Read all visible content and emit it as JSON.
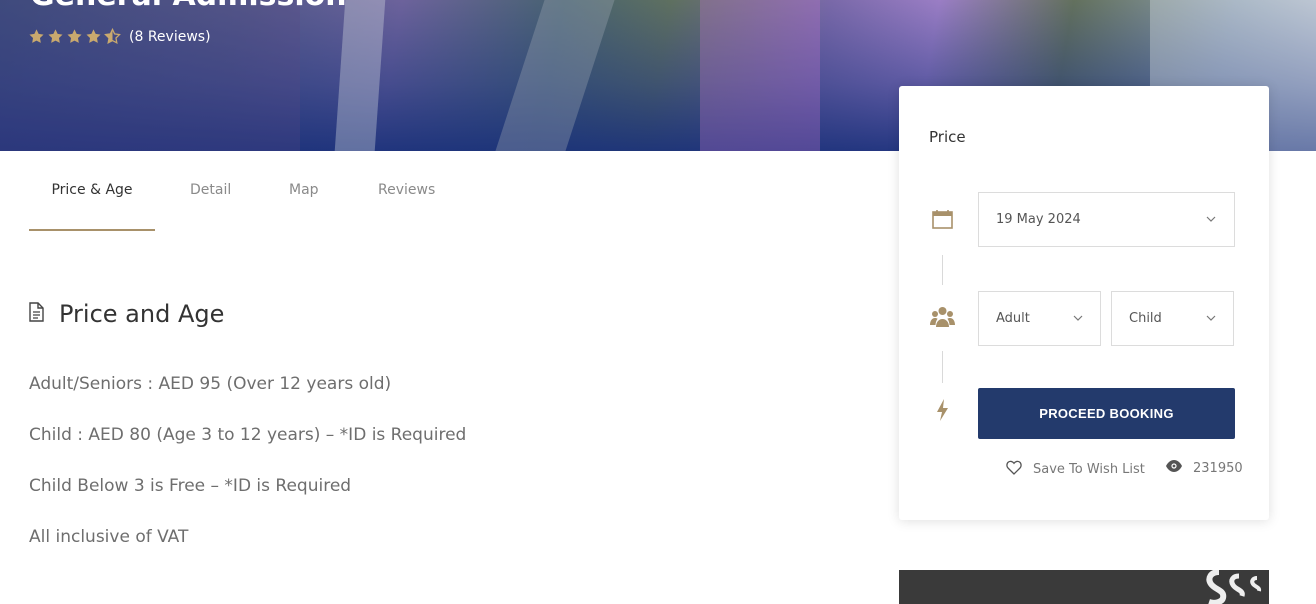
{
  "hero": {
    "title": "General Admission",
    "rating": 4.5,
    "reviews_text": "(8 Reviews)"
  },
  "tabs": [
    "Price & Age",
    "Detail",
    "Map",
    "Reviews"
  ],
  "section": {
    "title": "Price and Age",
    "icon": "document-icon",
    "lines": [
      "Adult/Seniors : AED 95 (Over 12 years old)",
      "Child : AED 80 (Age 3 to 12 years) – *ID is Required",
      "Child Below 3 is Free – *ID is Required",
      "All inclusive of VAT"
    ]
  },
  "booking": {
    "title": "Price",
    "date": "19 May 2024",
    "adult_label": "Adult",
    "child_label": "Child",
    "button": "PROCEED BOOKING",
    "wishlist": "Save To Wish List",
    "views": "231950"
  },
  "colors": {
    "accent": "#a8916a",
    "button": "#233a6c",
    "star": "#c9a96e"
  }
}
